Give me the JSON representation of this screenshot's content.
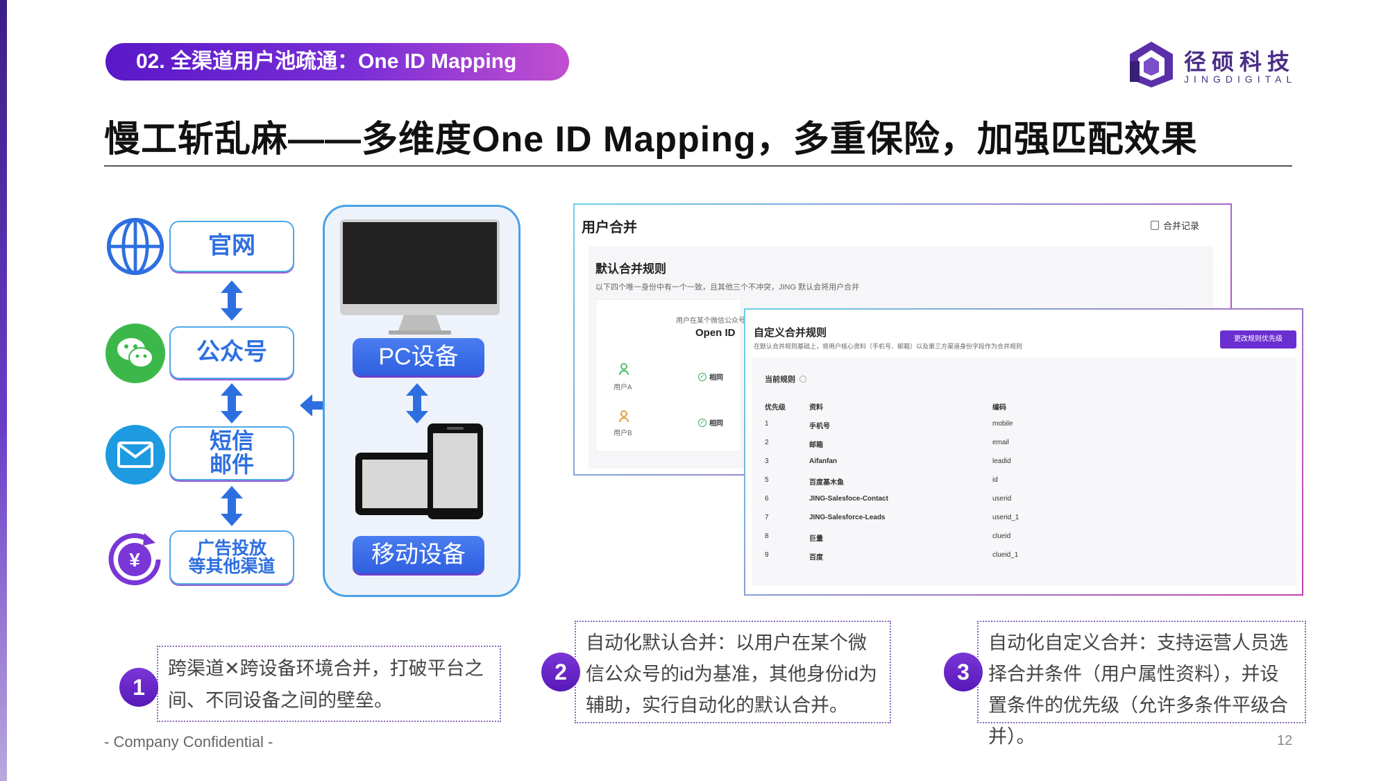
{
  "section": {
    "label": "02. 全渠道用户池疏通：One ID Mapping"
  },
  "logo": {
    "cn": "径硕科技",
    "en": "JINGDIGITAL"
  },
  "title": "慢工斩乱麻——多维度One ID Mapping，多重保险，加强匹配效果",
  "channels": [
    {
      "label": "官网",
      "icon": "globe-icon"
    },
    {
      "label": "公众号",
      "icon": "wechat-icon"
    },
    {
      "label": "短信\n邮件",
      "icon": "mail-icon"
    },
    {
      "label": "广告投放\n等其他渠道",
      "icon": "yuan-icon"
    }
  ],
  "devices": {
    "pc_label": "PC设备",
    "mobile_label": "移动设备"
  },
  "merge_screen": {
    "title": "用户合并",
    "history_link": "合并记录",
    "default_rules_title": "默认合并规则",
    "default_rules_desc": "以下四个唯一身份中有一个一致，且其他三个不冲突，JING 默认会将用户合并",
    "column_hint": "用户在某个微信公众号",
    "column_header": "Open ID",
    "users": [
      {
        "name": "用户A",
        "status": "相同"
      },
      {
        "name": "用户B",
        "status": "相同"
      }
    ]
  },
  "custom_screen": {
    "title": "自定义合并规则",
    "desc": "在默认合并规则基础上，将用户核心资料（手机号、邮箱）以及第三方渠道身份字段作为合并规则",
    "button": "更改规则优先级",
    "current_rules": "当前规则",
    "headers": [
      "优先级",
      "资料",
      "编码"
    ],
    "rows": [
      [
        "1",
        "手机号",
        "mobile"
      ],
      [
        "2",
        "邮箱",
        "email"
      ],
      [
        "3",
        "Aifanfan",
        "leadid"
      ],
      [
        "5",
        "百度基木鱼",
        "id"
      ],
      [
        "6",
        "JING-Salesfoce-Contact",
        "userid"
      ],
      [
        "7",
        "JING-Salesforce-Leads",
        "userid_1"
      ],
      [
        "8",
        "巨量",
        "clueid"
      ],
      [
        "9",
        "百度",
        "clueid_1"
      ]
    ]
  },
  "callouts": [
    {
      "num": "1",
      "text": "跨渠道✕跨设备环境合并，打破平台之间、不同设备之间的壁垒。"
    },
    {
      "num": "2",
      "text": "自动化默认合并：以用户在某个微信公众号的id为基准，其他身份id为辅助，实行自动化的默认合并。"
    },
    {
      "num": "3",
      "text": "自动化自定义合并：支持运营人员选择合并条件（用户属性资料），并设置条件的优先级（允许多条件平级合并）。"
    }
  ],
  "footer": {
    "confidential": "- Company Confidential -",
    "page": "12"
  },
  "colors": {
    "accent_purple": "#6a2fd0",
    "accent_blue": "#2e6fe0",
    "wechat_green": "#3cb84a",
    "mail_blue": "#1e9be0"
  }
}
